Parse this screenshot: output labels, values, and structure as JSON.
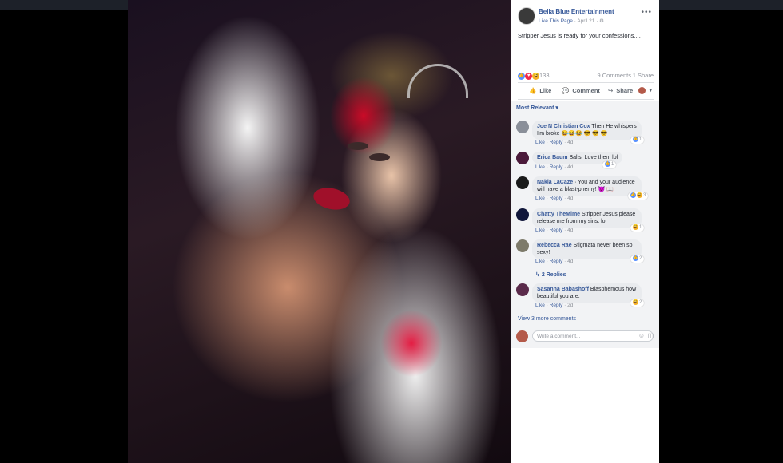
{
  "post": {
    "page_name": "Bella Blue Entertainment",
    "like_page": "Like This Page",
    "date": "April 21",
    "privacy_icon": "globe-icon",
    "text": "Stripper Jesus is ready for your confessions....",
    "reaction_count": "133",
    "comments_count": "9 Comments",
    "shares_count": "1 Share"
  },
  "actions": {
    "like": "Like",
    "comment": "Comment",
    "share": "Share"
  },
  "sort_label": "Most Relevant",
  "comments": [
    {
      "name": "Joe N Christian Cox",
      "text": "Then He whispers I'm broke 😂😂😂 😎 😎 😎",
      "like": "Like",
      "reply": "Reply",
      "time": "4d",
      "reactions": "1"
    },
    {
      "name": "Erica Baum",
      "text": "Balls! Love them lol",
      "like": "Like",
      "reply": "Reply",
      "time": "4d",
      "reactions": "1"
    },
    {
      "name": "Nakia LaCaze",
      "text": "· You and your audience will have a blast-phemy! 😈 📖",
      "like": "Like",
      "reply": "Reply",
      "time": "4d",
      "reactions": "3"
    },
    {
      "name": "Chatty TheMime",
      "text": "Stripper Jesus please release me from my sins. lol",
      "like": "Like",
      "reply": "Reply",
      "time": "4d",
      "reactions": "1"
    },
    {
      "name": "Rebecca Rae",
      "text": "Stigmata never been so sexy!",
      "like": "Like",
      "reply": "Reply",
      "time": "4d",
      "reactions": "2"
    },
    {
      "name": "Sasanna Babashoff",
      "text": "Blasphemous how beautiful you are.",
      "like": "Like",
      "reply": "Reply",
      "time": "2d",
      "reactions": "2"
    }
  ],
  "replies_label": "2 Replies",
  "view_more": "View 3 more comments",
  "write_placeholder": "Write a comment..."
}
